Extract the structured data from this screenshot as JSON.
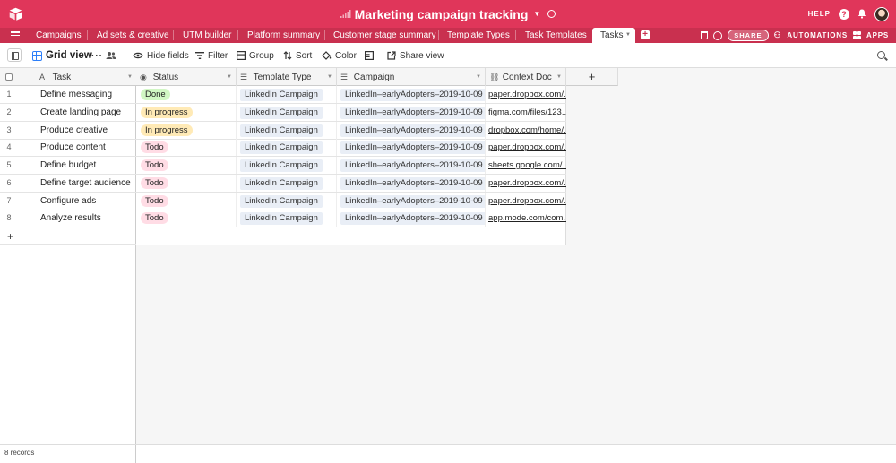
{
  "header": {
    "base_title": "Marketing campaign tracking",
    "help": "HELP",
    "help_q": "?"
  },
  "tabs": {
    "items": [
      {
        "label": "Campaigns"
      },
      {
        "label": "Ad sets & creative"
      },
      {
        "label": "UTM builder"
      },
      {
        "label": "Platform summary"
      },
      {
        "label": "Customer stage summary"
      },
      {
        "label": "Template Types"
      },
      {
        "label": "Task Templates"
      }
    ],
    "active": "Tasks",
    "add": "+",
    "share": "SHARE",
    "automations": "AUTOMATIONS",
    "apps": "APPS"
  },
  "toolbar": {
    "view_name": "Grid view",
    "more": "···",
    "hide_fields": "Hide fields",
    "filter": "Filter",
    "group": "Group",
    "sort": "Sort",
    "color": "Color",
    "share_view": "Share view"
  },
  "grid": {
    "columns": {
      "task": "Task",
      "status": "Status",
      "template_type": "Template Type",
      "campaign": "Campaign",
      "context_doc": "Context Doc"
    },
    "add_column": "+",
    "add_row": "+",
    "rows": [
      {
        "n": "1",
        "task": "Define messaging",
        "status": "Done",
        "template_type": "LinkedIn Campaign",
        "campaign": "LinkedIn–earlyAdopters–2019-10-09",
        "context_doc": "paper.dropbox.com/..."
      },
      {
        "n": "2",
        "task": "Create landing page",
        "status": "In progress",
        "template_type": "LinkedIn Campaign",
        "campaign": "LinkedIn–earlyAdopters–2019-10-09",
        "context_doc": "figma.com/files/123..."
      },
      {
        "n": "3",
        "task": "Produce creative",
        "status": "In progress",
        "template_type": "LinkedIn Campaign",
        "campaign": "LinkedIn–earlyAdopters–2019-10-09",
        "context_doc": "dropbox.com/home/..."
      },
      {
        "n": "4",
        "task": "Produce content",
        "status": "Todo",
        "template_type": "LinkedIn Campaign",
        "campaign": "LinkedIn–earlyAdopters–2019-10-09",
        "context_doc": "paper.dropbox.com/..."
      },
      {
        "n": "5",
        "task": "Define budget",
        "status": "Todo",
        "template_type": "LinkedIn Campaign",
        "campaign": "LinkedIn–earlyAdopters–2019-10-09",
        "context_doc": "sheets.google.com/..."
      },
      {
        "n": "6",
        "task": "Define target audience",
        "status": "Todo",
        "template_type": "LinkedIn Campaign",
        "campaign": "LinkedIn–earlyAdopters–2019-10-09",
        "context_doc": "paper.dropbox.com/..."
      },
      {
        "n": "7",
        "task": "Configure ads",
        "status": "Todo",
        "template_type": "LinkedIn Campaign",
        "campaign": "LinkedIn–earlyAdopters–2019-10-09",
        "context_doc": "paper.dropbox.com/..."
      },
      {
        "n": "8",
        "task": "Analyze results",
        "status": "Todo",
        "template_type": "LinkedIn Campaign",
        "campaign": "LinkedIn–earlyAdopters–2019-10-09",
        "context_doc": "app.mode.com/com..."
      }
    ],
    "record_count": "8 records"
  },
  "colors": {
    "header_bg": "#e0365a",
    "tabbar_bg": "#c9304f",
    "status_done_bg": "#d1f7c4",
    "status_in_progress_bg": "#ffeab6",
    "status_todo_bg": "#ffdce5",
    "chip_bg": "#e9eef6"
  },
  "icons": {
    "logo": "airtable-logo",
    "signal": "signal-bars-icon",
    "info": "info-icon",
    "bell": "bell-icon",
    "avatar": "user-avatar"
  }
}
